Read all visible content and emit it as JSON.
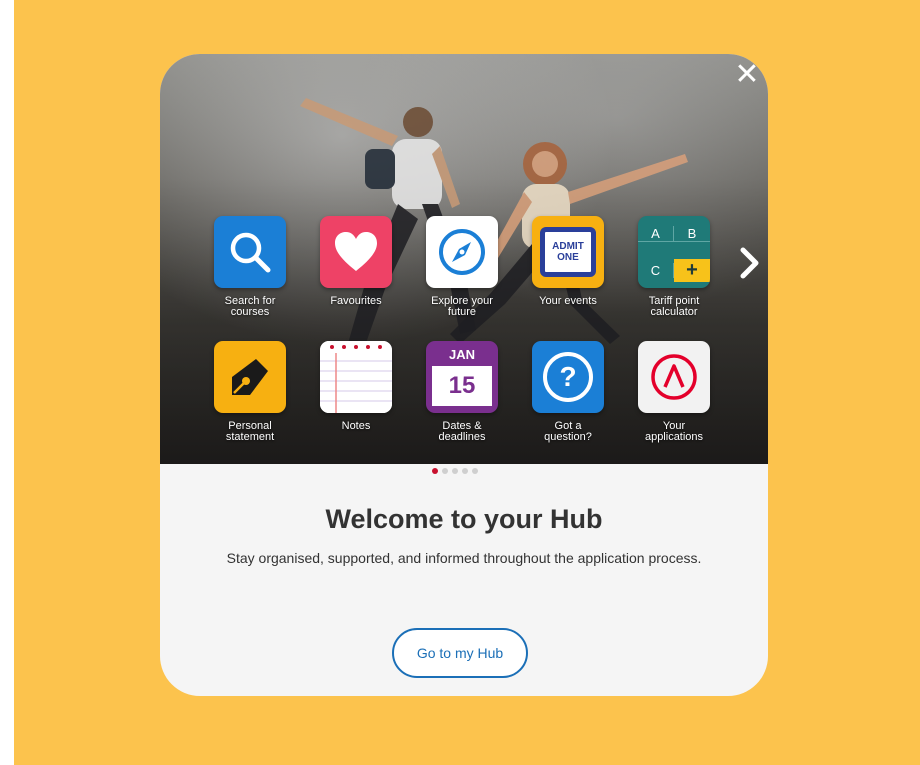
{
  "modal": {
    "close_glyph": "✕",
    "title": "Welcome to your Hub",
    "subtitle": "Stay organised, supported, and informed throughout the application process.",
    "cta_label": "Go to my Hub",
    "pagination": {
      "total": 5,
      "active": 1
    }
  },
  "tiles": [
    {
      "label": "Search for courses",
      "icon": "search-icon",
      "color": "#1b7fd6"
    },
    {
      "label": "Favourites",
      "icon": "heart-icon",
      "color": "#ee4266"
    },
    {
      "label": "Explore your future",
      "icon": "compass-icon",
      "color": "#ffffff"
    },
    {
      "label": "Your events",
      "icon": "ticket-icon",
      "ticket_line1": "ADMIT",
      "ticket_line2": "ONE",
      "color": "#2a3f9a"
    },
    {
      "label": "Tariff point calculator",
      "icon": "calculator-icon",
      "keys": [
        "A",
        "B",
        "C",
        "+"
      ],
      "color": "#1f7a78"
    },
    {
      "label": "Personal statement",
      "icon": "pen-icon",
      "color": "#f7b011"
    },
    {
      "label": "Notes",
      "icon": "notepad-icon",
      "color": "#ffffff"
    },
    {
      "label": "Dates & deadlines",
      "icon": "calendar-icon",
      "month": "JAN",
      "day": "15",
      "color": "#7a2f8e"
    },
    {
      "label": "Got a question?",
      "icon": "question-icon",
      "glyph": "?",
      "color": "#1b7fd6"
    },
    {
      "label": "Your applications",
      "icon": "applications-icon",
      "color": "#e4002b"
    }
  ]
}
